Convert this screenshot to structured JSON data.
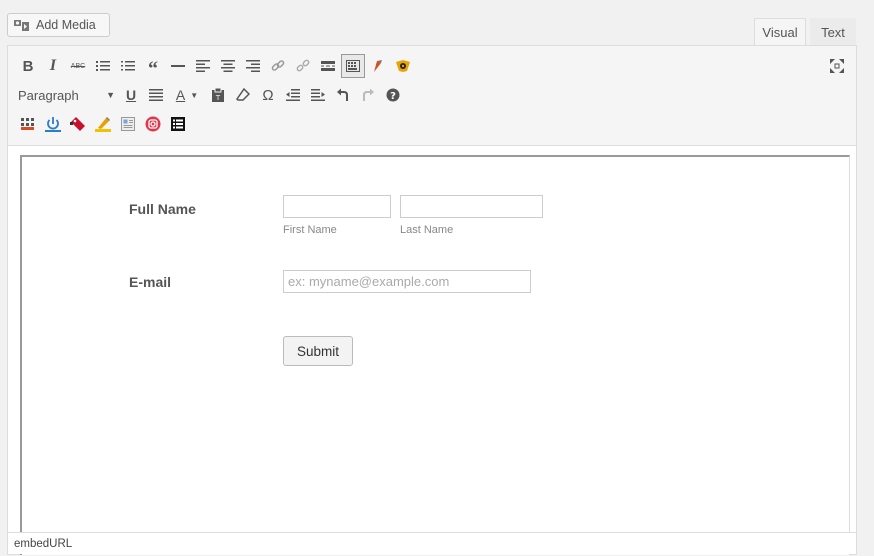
{
  "media": {
    "add_label": "Add Media"
  },
  "tabs": {
    "visual": "Visual",
    "text": "Text"
  },
  "toolbar": {
    "format_select": "Paragraph",
    "colors": {
      "accent_red": "#d54e21",
      "active_border": "#999999"
    }
  },
  "form": {
    "full_name_label": "Full Name",
    "first_name_sublabel": "First Name",
    "last_name_sublabel": "Last Name",
    "email_label": "E-mail",
    "email_placeholder": "ex: myname@example.com",
    "submit_label": "Submit"
  },
  "statusbar": {
    "path": "embedURL"
  }
}
